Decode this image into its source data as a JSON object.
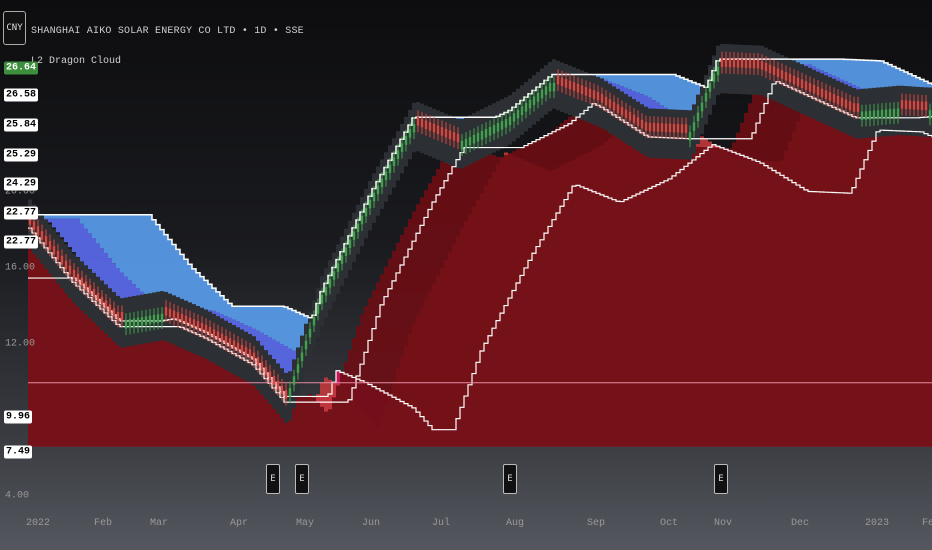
{
  "header": {
    "currency": "CNY",
    "symbol_title": "SHANGHAI AIKO SOLAR ENERGY CO LTD • 1D • SSE",
    "indicator": "L2 Dragon Cloud"
  },
  "y_axis": {
    "ticks": [
      "20.00",
      "16.00",
      "12.00",
      "4.00"
    ],
    "badges": [
      {
        "label": "26.64",
        "value": 26.64,
        "bg": "#3d8f3d",
        "fg": "#ffffff"
      },
      {
        "label": "26.58",
        "value": 26.58,
        "bg": "#ffffff",
        "fg": "#000000"
      },
      {
        "label": "25.84",
        "value": 25.84,
        "bg": "#ffffff",
        "fg": "#000000"
      },
      {
        "label": "25.29",
        "value": 25.29,
        "bg": "#ffffff",
        "fg": "#000000"
      },
      {
        "label": "24.29",
        "value": 24.29,
        "bg": "#ffffff",
        "fg": "#000000"
      },
      {
        "label": "22.77",
        "value": 22.77,
        "bg": "#ffffff",
        "fg": "#000000"
      },
      {
        "label": "22.77",
        "value": 22.77,
        "bg": "#ffffff",
        "fg": "#000000"
      },
      {
        "label": "9.96",
        "value": 9.96,
        "bg": "#ffffff",
        "fg": "#000000"
      },
      {
        "label": "7.49",
        "value": 7.49,
        "bg": "#ffffff",
        "fg": "#000000"
      }
    ]
  },
  "x_axis": {
    "labels": [
      "2022",
      "Feb",
      "Mar",
      "Apr",
      "May",
      "Jun",
      "Jul",
      "Aug",
      "Sep",
      "Oct",
      "Nov",
      "Dec",
      "2023",
      "Fe"
    ]
  },
  "earnings_markers": [
    "E",
    "E",
    "E",
    "E"
  ],
  "colors": {
    "crimson_cloud": "#c2185b",
    "red_cloud": "#c0393b",
    "dark_red_cloud": "#6d0d14",
    "blue_cloud": "#5c6cf0",
    "light_blue_cloud": "#5aa0f0",
    "up_candle": "#3fa34d",
    "down_candle": "#e0433b",
    "price_band": "#2c2f33"
  },
  "chart_data": {
    "type": "candlestick-cloud",
    "title": "SHANGHAI AIKO SOLAR ENERGY CO LTD • 1D • SSE",
    "indicator": "L2 Dragon Cloud",
    "x_range": [
      "2022-01",
      "2023-02"
    ],
    "ylim": [
      4,
      28
    ],
    "close_path": [
      {
        "date": "2022-01-01",
        "close": 18.4
      },
      {
        "date": "2022-01-20",
        "close": 15.6
      },
      {
        "date": "2022-02-10",
        "close": 13.2
      },
      {
        "date": "2022-03-01",
        "close": 13.6
      },
      {
        "date": "2022-03-20",
        "close": 12.6
      },
      {
        "date": "2022-04-10",
        "close": 11.2
      },
      {
        "date": "2022-04-25",
        "close": 9.1
      },
      {
        "date": "2022-05-10",
        "close": 14.4
      },
      {
        "date": "2022-06-01",
        "close": 19.6
      },
      {
        "date": "2022-06-20",
        "close": 23.6
      },
      {
        "date": "2022-07-10",
        "close": 22.6
      },
      {
        "date": "2022-08-01",
        "close": 23.9
      },
      {
        "date": "2022-08-20",
        "close": 25.8
      },
      {
        "date": "2022-09-10",
        "close": 24.8
      },
      {
        "date": "2022-10-01",
        "close": 23.2
      },
      {
        "date": "2022-10-20",
        "close": 23.1
      },
      {
        "date": "2022-11-01",
        "close": 26.6
      },
      {
        "date": "2022-11-20",
        "close": 26.5
      },
      {
        "date": "2022-12-10",
        "close": 25.4
      },
      {
        "date": "2023-01-01",
        "close": 24.2
      },
      {
        "date": "2023-01-20",
        "close": 24.4
      },
      {
        "date": "2023-02-01",
        "close": 24.3
      }
    ],
    "price_levels": [
      26.64,
      26.58,
      25.84,
      25.29,
      24.29,
      22.77,
      22.77,
      9.96,
      7.49
    ],
    "legend": "none",
    "grid": false
  }
}
